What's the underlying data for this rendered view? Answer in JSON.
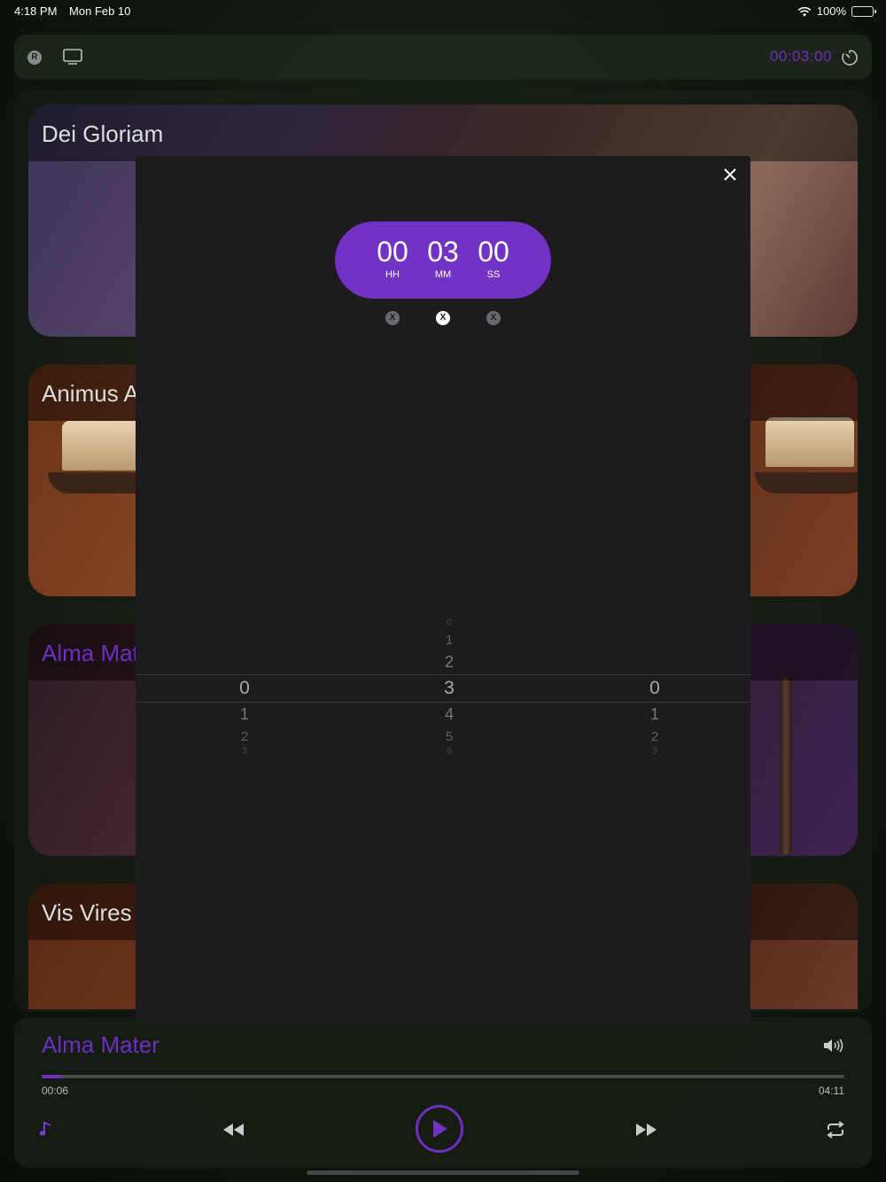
{
  "status_bar": {
    "time": "4:18 PM",
    "date": "Mon Feb 10",
    "battery": "100%"
  },
  "toolbar": {
    "badge": "R",
    "timer": "00:03:00"
  },
  "tracks": [
    "Dei Gloriam",
    "Animus A",
    "Alma Mat",
    "Vis Vires"
  ],
  "timer_modal": {
    "hours": "00",
    "minutes": "03",
    "seconds": "00",
    "hours_label": "HH",
    "minutes_label": "MM",
    "seconds_label": "SS",
    "clear_label": "X",
    "wheels": {
      "hours": [
        "",
        "",
        "",
        "0",
        "1",
        "2",
        "3"
      ],
      "minutes": [
        "0",
        "1",
        "2",
        "3",
        "4",
        "5",
        "6"
      ],
      "seconds": [
        "",
        "",
        "",
        "0",
        "1",
        "2",
        "3"
      ]
    }
  },
  "player": {
    "song": "Alma Mater",
    "current_time": "00:06",
    "total_time": "04:11",
    "progress": 0.024
  },
  "colors": {
    "accent": "#7232c4",
    "modal_bg": "#1c1c1e"
  }
}
